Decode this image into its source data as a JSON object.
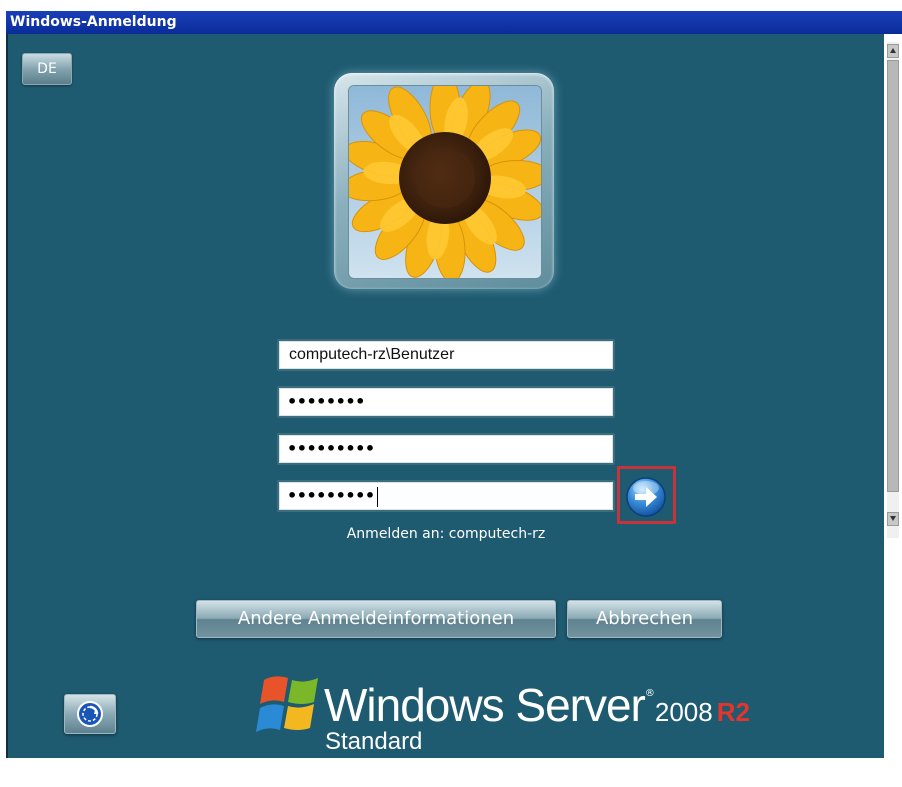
{
  "window": {
    "title": "Windows-Anmeldung"
  },
  "language": {
    "label": "DE"
  },
  "avatar": {
    "icon": "sunflower-user-picture"
  },
  "fields": {
    "username": "computech-rz\\Benutzer",
    "password1": "••••••••",
    "password2": "•••••••••",
    "password3": "•••••••••"
  },
  "logon_to": "Anmelden an: computech-rz",
  "buttons": {
    "other_credentials": "Andere Anmeldeinformationen",
    "cancel": "Abbrechen"
  },
  "branding": {
    "product": "Windows Server",
    "trademark": "®",
    "version": "2008",
    "release": "R2",
    "edition": "Standard"
  },
  "colors": {
    "background": "#1e5a70",
    "titlebar": "#0a2c9a",
    "highlight": "#c4343a",
    "r2": "#e4342c"
  }
}
